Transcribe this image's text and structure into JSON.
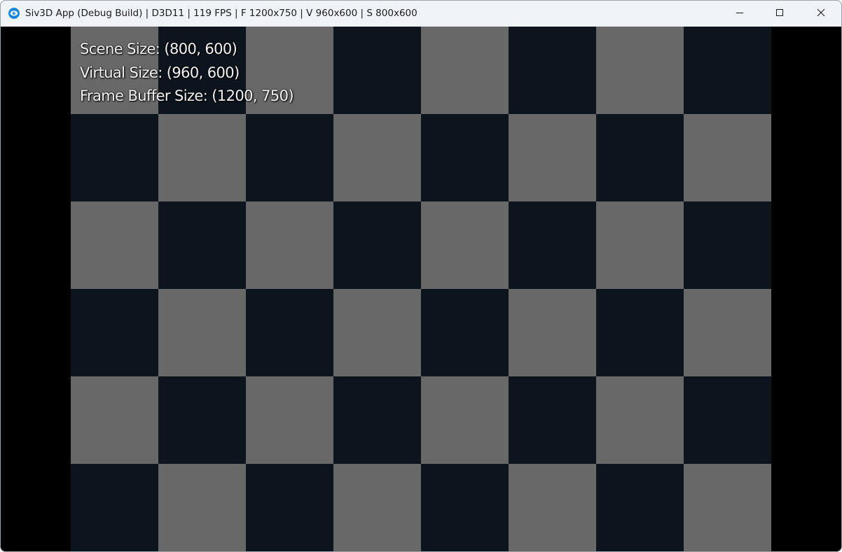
{
  "window": {
    "title": "Siv3D App (Debug Build) | D3D11 | 119 FPS | F 1200x750 | V 960x600 | S 800x600",
    "icon": "siv3d-app-icon",
    "controls": {
      "minimize_icon": "minimize-icon",
      "maximize_icon": "maximize-icon",
      "close_icon": "close-icon"
    }
  },
  "scene": {
    "grid": {
      "columns": 8,
      "rows": 6,
      "light_color": "#686868",
      "dark_color": "#0c141d",
      "letterbox_color": "#000000",
      "top_left_is_light": true
    },
    "info_lines": [
      "Scene Size: (800, 600)",
      "Virtual Size: (960, 600)",
      "Frame Buffer Size: (1200, 750)"
    ]
  }
}
